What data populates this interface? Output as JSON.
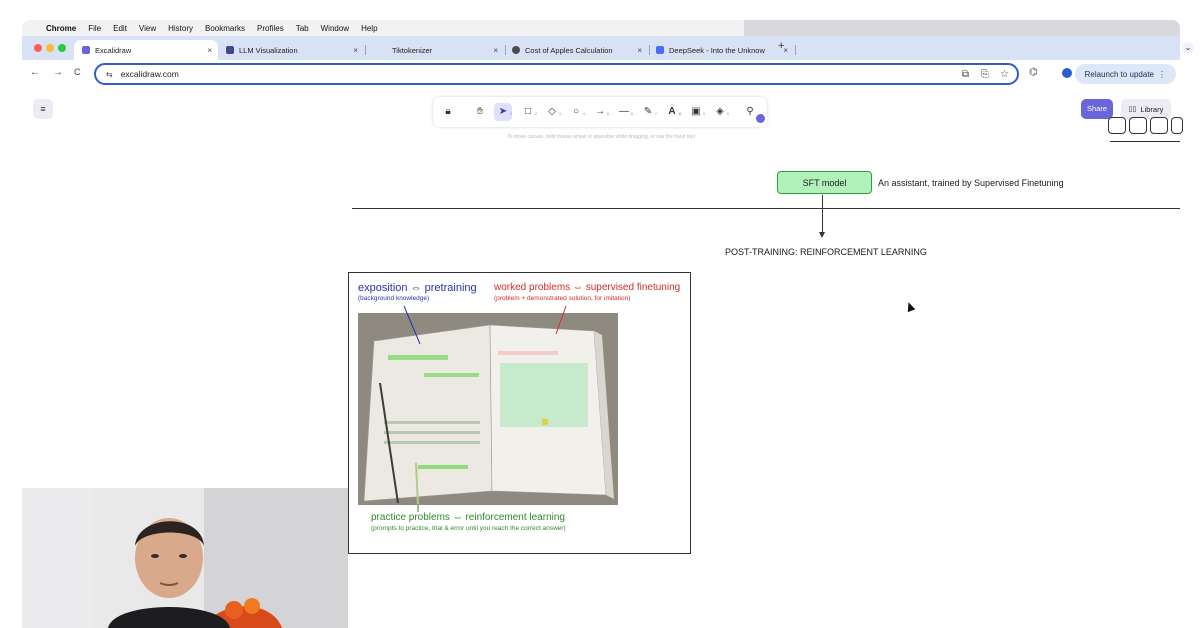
{
  "menubar": {
    "items": [
      "Chrome",
      "File",
      "Edit",
      "View",
      "History",
      "Bookmarks",
      "Profiles",
      "Tab",
      "Window",
      "Help"
    ]
  },
  "tabs": [
    {
      "title": "Excalidraw",
      "close": "×",
      "icon_color": "#6965db"
    },
    {
      "title": "LLM Visualization",
      "close": "×",
      "icon_color": "#3b4a8a"
    },
    {
      "title": "Tiktokenizer",
      "close": "×",
      "icon_color": "#ffffff"
    },
    {
      "title": "Cost of Apples Calculation",
      "close": "×",
      "icon_color": "#4a4a4a"
    },
    {
      "title": "DeepSeek - Into the Unknow",
      "close": "×",
      "icon_color": "#4d6bfe"
    }
  ],
  "newtab": "+",
  "toolbar": {
    "back": "←",
    "forward": "→",
    "reload": "C",
    "site_icon": "⇆",
    "url": "excalidraw.com",
    "relaunch": "Relaunch to update",
    "relaunch_more": "⋮"
  },
  "excalidraw": {
    "menu_icon": "≡",
    "tools": [
      {
        "name": "lock-tool",
        "glyph": "🔒︎",
        "key": ""
      },
      {
        "name": "hand-tool",
        "glyph": "✋︎",
        "key": ""
      },
      {
        "name": "selection-tool",
        "glyph": "➤",
        "key": "1"
      },
      {
        "name": "rectangle-tool",
        "glyph": "□",
        "key": "2"
      },
      {
        "name": "diamond-tool",
        "glyph": "◇",
        "key": "3"
      },
      {
        "name": "ellipse-tool",
        "glyph": "○",
        "key": "4"
      },
      {
        "name": "arrow-tool",
        "glyph": "→",
        "key": "5"
      },
      {
        "name": "line-tool",
        "glyph": "—",
        "key": "6"
      },
      {
        "name": "draw-tool",
        "glyph": "✎",
        "key": "7"
      },
      {
        "name": "text-tool",
        "glyph": "A",
        "key": "8"
      },
      {
        "name": "image-tool",
        "glyph": "▣",
        "key": "9"
      },
      {
        "name": "eraser-tool",
        "glyph": "◈",
        "key": "0"
      },
      {
        "name": "more-tools",
        "glyph": "⚲",
        "key": ""
      }
    ],
    "hint": "To move canvas, hold mouse wheel or spacebar while dragging, or use the hand tool",
    "share": "Share",
    "library": "Library",
    "library_icon": "▯▯"
  },
  "diagram": {
    "sft_model": "SFT model",
    "sft_desc": "An assistant, trained by Supervised Finetuning",
    "post_training": "POST-TRAINING: REINFORCEMENT LEARNING"
  },
  "figure": {
    "exposition": "exposition ⇔ pretraining",
    "exposition_sub": "(background knowledge)",
    "worked": "worked problems ⇔ supervised finetuning",
    "worked_sub": "(problem + demonstrated solution, for imitation)",
    "practice": "practice problems ⇔ reinforcement learning",
    "practice_sub": "(prompts to practice, trial & error until you reach the correct answer)"
  }
}
